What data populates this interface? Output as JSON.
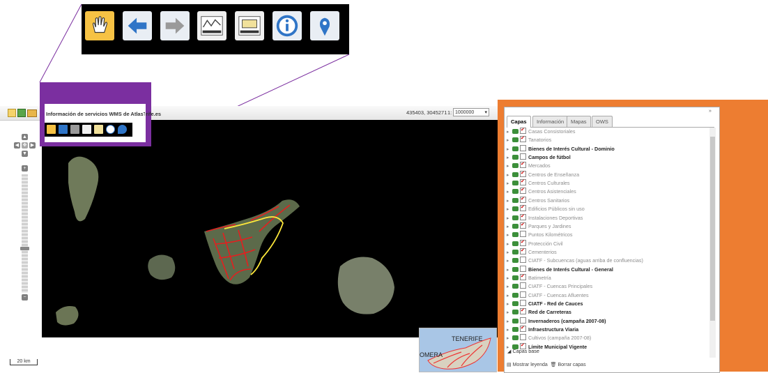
{
  "header": {
    "title": "Información de servicios WMS de AtlasTenerife.es",
    "coords": "435403, 3045271",
    "scale_prefix": "1:",
    "scale_value": "1000000"
  },
  "toolbar": {
    "tools": [
      {
        "name": "pan-hand-icon"
      },
      {
        "name": "back-arrow-icon"
      },
      {
        "name": "forward-arrow-icon"
      },
      {
        "name": "measure-line-icon"
      },
      {
        "name": "measure-area-icon"
      },
      {
        "name": "info-icon"
      },
      {
        "name": "marker-pin-icon"
      }
    ]
  },
  "map": {
    "scale_label": "20 km",
    "overview_labels": [
      "TENERIFE",
      "OMERA"
    ]
  },
  "panel": {
    "collapse": "»",
    "tabs": [
      "Capas",
      "Información",
      "Mapas",
      "OWS"
    ],
    "active_tab": "Capas",
    "layers": [
      {
        "label": "Casas Consistoriales",
        "checked": true,
        "style": "dim"
      },
      {
        "label": "Tanatorios",
        "checked": true,
        "style": "dim"
      },
      {
        "label": "Bienes de Interés Cultural - Dominio",
        "checked": false,
        "style": "bold"
      },
      {
        "label": "Campos de fútbol",
        "checked": false,
        "style": "bold"
      },
      {
        "label": "Mercados",
        "checked": true,
        "style": "dim"
      },
      {
        "label": "Centros de Enseñanza",
        "checked": true,
        "style": "dim"
      },
      {
        "label": "Centros Culturales",
        "checked": true,
        "style": "dim"
      },
      {
        "label": "Centros Asistenciales",
        "checked": true,
        "style": "dim"
      },
      {
        "label": "Centros Sanitarios",
        "checked": true,
        "style": "dim"
      },
      {
        "label": "Edificios Públicos sin uso",
        "checked": true,
        "style": "dim"
      },
      {
        "label": "Instalaciones Deportivas",
        "checked": true,
        "style": "dim"
      },
      {
        "label": "Parques y Jardines",
        "checked": true,
        "style": "dim"
      },
      {
        "label": "Puntos Kilométricos",
        "checked": false,
        "style": "dim"
      },
      {
        "label": "Protección Civil",
        "checked": true,
        "style": "dim"
      },
      {
        "label": "Cementerios",
        "checked": true,
        "style": "dim"
      },
      {
        "label": "CIATF - Subcuencas (aguas arriba de confluencias)",
        "checked": false,
        "style": "dim"
      },
      {
        "label": "Bienes de Interés Cultural - General",
        "checked": false,
        "style": "bold"
      },
      {
        "label": "Batimetría",
        "checked": true,
        "style": "dim"
      },
      {
        "label": "CIATF - Cuencas Principales",
        "checked": false,
        "style": "dim"
      },
      {
        "label": "CIATF - Cuencas Afluentes",
        "checked": false,
        "style": "dim"
      },
      {
        "label": "CIATF - Red de Cauces",
        "checked": false,
        "style": "bold"
      },
      {
        "label": "Red de Carreteras",
        "checked": true,
        "style": "bold"
      },
      {
        "label": "Invernaderos (campaña 2007-08)",
        "checked": false,
        "style": "bold"
      },
      {
        "label": "Infraestructura Viaria",
        "checked": true,
        "style": "bold"
      },
      {
        "label": "Cultivos (campaña 2007-08)",
        "checked": false,
        "style": "dim"
      },
      {
        "label": "Límite Municipal Vigente",
        "checked": true,
        "style": "bold"
      }
    ],
    "base_group": "Capas base",
    "footer_legend": "Mostrar leyenda",
    "footer_clear": "Borrar capas"
  }
}
